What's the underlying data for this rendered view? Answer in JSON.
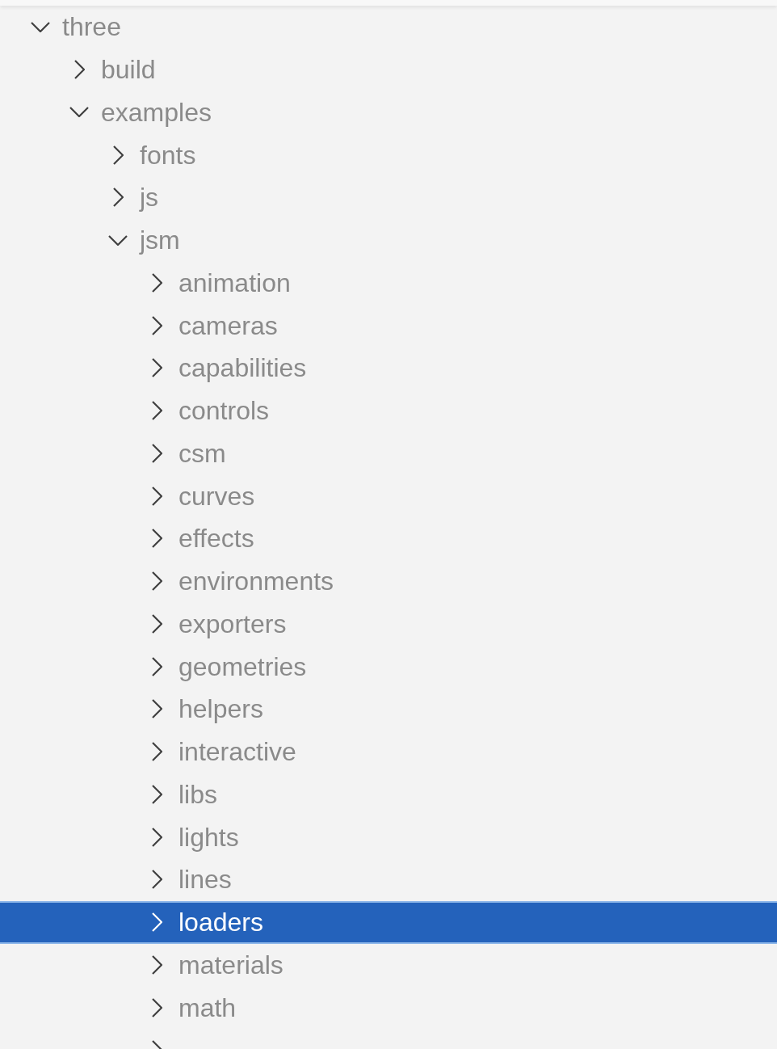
{
  "explorer": {
    "items": [
      {
        "label": "three",
        "expanded": true,
        "selected": false,
        "children": [
          {
            "label": "build",
            "expanded": false,
            "selected": false
          },
          {
            "label": "examples",
            "expanded": true,
            "selected": false,
            "children": [
              {
                "label": "fonts",
                "expanded": false,
                "selected": false
              },
              {
                "label": "js",
                "expanded": false,
                "selected": false
              },
              {
                "label": "jsm",
                "expanded": true,
                "selected": false,
                "children": [
                  {
                    "label": "animation",
                    "expanded": false,
                    "selected": false
                  },
                  {
                    "label": "cameras",
                    "expanded": false,
                    "selected": false
                  },
                  {
                    "label": "capabilities",
                    "expanded": false,
                    "selected": false
                  },
                  {
                    "label": "controls",
                    "expanded": false,
                    "selected": false
                  },
                  {
                    "label": "csm",
                    "expanded": false,
                    "selected": false
                  },
                  {
                    "label": "curves",
                    "expanded": false,
                    "selected": false
                  },
                  {
                    "label": "effects",
                    "expanded": false,
                    "selected": false
                  },
                  {
                    "label": "environments",
                    "expanded": false,
                    "selected": false
                  },
                  {
                    "label": "exporters",
                    "expanded": false,
                    "selected": false
                  },
                  {
                    "label": "geometries",
                    "expanded": false,
                    "selected": false
                  },
                  {
                    "label": "helpers",
                    "expanded": false,
                    "selected": false
                  },
                  {
                    "label": "interactive",
                    "expanded": false,
                    "selected": false
                  },
                  {
                    "label": "libs",
                    "expanded": false,
                    "selected": false
                  },
                  {
                    "label": "lights",
                    "expanded": false,
                    "selected": false
                  },
                  {
                    "label": "lines",
                    "expanded": false,
                    "selected": false
                  },
                  {
                    "label": "loaders",
                    "expanded": false,
                    "selected": true
                  },
                  {
                    "label": "materials",
                    "expanded": false,
                    "selected": false
                  },
                  {
                    "label": "math",
                    "expanded": false,
                    "selected": false
                  },
                  {
                    "expanded": false,
                    "selected": false
                  }
                ]
              }
            ]
          }
        ]
      }
    ]
  }
}
